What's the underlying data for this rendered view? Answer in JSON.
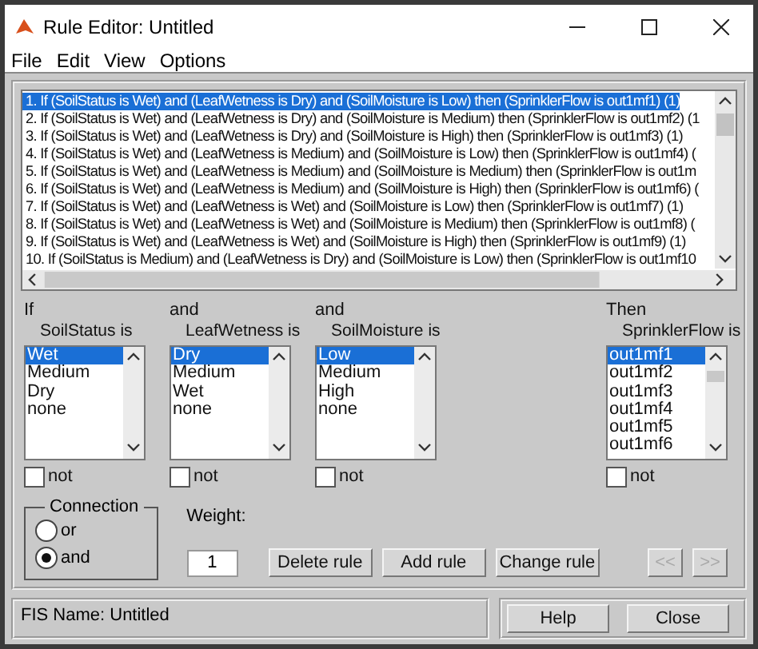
{
  "window": {
    "title": "Rule Editor: Untitled"
  },
  "menu": [
    "File",
    "Edit",
    "View",
    "Options"
  ],
  "rules": [
    {
      "text": "1. If (SoilStatus is Wet) and (LeafWetness is Dry) and (SoilMoisture is Low) then (SprinklerFlow is out1mf1) (1)",
      "selected": true
    },
    {
      "text": "2. If (SoilStatus is Wet) and (LeafWetness is Dry) and (SoilMoisture is Medium) then (SprinklerFlow is out1mf2) (1",
      "selected": false
    },
    {
      "text": "3. If (SoilStatus is Wet) and (LeafWetness is Dry) and (SoilMoisture is High) then (SprinklerFlow is out1mf3) (1)",
      "selected": false
    },
    {
      "text": "4. If (SoilStatus is Wet) and (LeafWetness is Medium) and (SoilMoisture is Low) then (SprinklerFlow is out1mf4) (",
      "selected": false
    },
    {
      "text": "5. If (SoilStatus is Wet) and (LeafWetness is Medium) and (SoilMoisture is Medium) then (SprinklerFlow is out1m",
      "selected": false
    },
    {
      "text": "6. If (SoilStatus is Wet) and (LeafWetness is Medium) and (SoilMoisture is High) then (SprinklerFlow is out1mf6) (",
      "selected": false
    },
    {
      "text": "7. If (SoilStatus is Wet) and (LeafWetness is Wet) and (SoilMoisture is Low) then (SprinklerFlow is out1mf7) (1)",
      "selected": false
    },
    {
      "text": "8. If (SoilStatus is Wet) and (LeafWetness is Wet) and (SoilMoisture is Medium) then (SprinklerFlow is out1mf8) (",
      "selected": false
    },
    {
      "text": "9. If (SoilStatus is Wet) and (LeafWetness is Wet) and (SoilMoisture is High) then (SprinklerFlow is out1mf9) (1)",
      "selected": false
    },
    {
      "text": "10. If (SoilStatus is Medium) and (LeafWetness is Dry) and (SoilMoisture is Low) then (SprinklerFlow is out1mf10",
      "selected": false
    }
  ],
  "antecedents": [
    {
      "connector": "If",
      "label": "SoilStatus is",
      "options": [
        {
          "label": "Wet",
          "selected": true
        },
        {
          "label": "Medium",
          "selected": false
        },
        {
          "label": "Dry",
          "selected": false
        },
        {
          "label": "none",
          "selected": false
        }
      ],
      "not": false,
      "not_label": "not"
    },
    {
      "connector": "and",
      "label": "LeafWetness is",
      "options": [
        {
          "label": "Dry",
          "selected": true
        },
        {
          "label": "Medium",
          "selected": false
        },
        {
          "label": "Wet",
          "selected": false
        },
        {
          "label": "none",
          "selected": false
        }
      ],
      "not": false,
      "not_label": "not"
    },
    {
      "connector": "and",
      "label": "SoilMoisture is",
      "options": [
        {
          "label": "Low",
          "selected": true
        },
        {
          "label": "Medium",
          "selected": false
        },
        {
          "label": "High",
          "selected": false
        },
        {
          "label": "none",
          "selected": false
        }
      ],
      "not": false,
      "not_label": "not"
    }
  ],
  "consequent": {
    "connector": "Then",
    "label": "SprinklerFlow is",
    "options": [
      {
        "label": "out1mf1",
        "selected": true
      },
      {
        "label": "out1mf2",
        "selected": false
      },
      {
        "label": "out1mf3",
        "selected": false
      },
      {
        "label": "out1mf4",
        "selected": false
      },
      {
        "label": "out1mf5",
        "selected": false
      },
      {
        "label": "out1mf6",
        "selected": false
      }
    ],
    "not": false,
    "not_label": "not"
  },
  "connection": {
    "title": "Connection",
    "options": [
      {
        "label": "or",
        "selected": false
      },
      {
        "label": "and",
        "selected": true
      }
    ]
  },
  "weight": {
    "label": "Weight:",
    "value": "1"
  },
  "buttons": [
    {
      "label": "Delete rule",
      "disabled": false
    },
    {
      "label": "Add rule",
      "disabled": false
    },
    {
      "label": "Change rule",
      "disabled": false
    }
  ],
  "nav_buttons": [
    {
      "label": "<<",
      "disabled": true
    },
    {
      "label": ">>",
      "disabled": true
    }
  ],
  "status": "FIS Name: Untitled",
  "footer_buttons": [
    {
      "label": "Help"
    },
    {
      "label": "Close"
    }
  ]
}
